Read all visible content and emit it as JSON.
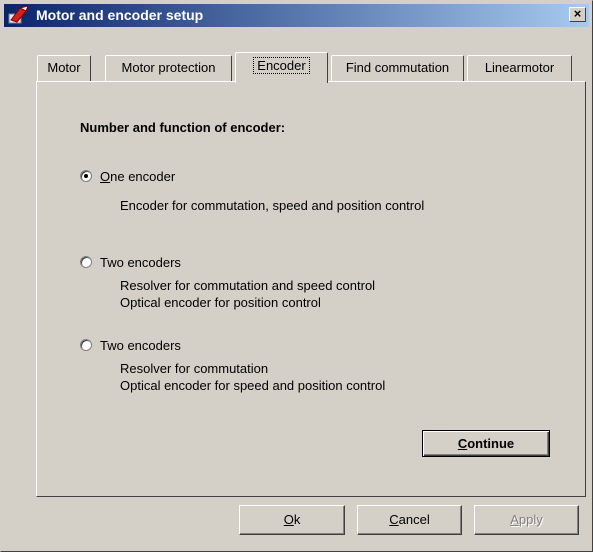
{
  "window": {
    "title": "Motor and encoder setup",
    "icon": "motor-app-icon",
    "close_glyph": "×"
  },
  "tabs": [
    {
      "label": "Motor",
      "active": false
    },
    {
      "label": "Motor protection",
      "active": false
    },
    {
      "label": "Encoder",
      "active": true
    },
    {
      "label": "Find commutation",
      "active": false
    },
    {
      "label": "Linearmotor",
      "active": false
    }
  ],
  "panel": {
    "heading": "Number and function of encoder:",
    "options": [
      {
        "label_mnemonic": "O",
        "label_rest": "ne encoder",
        "selected": true,
        "desc": [
          "Encoder for commutation, speed and position control"
        ]
      },
      {
        "label": "Two encoders",
        "selected": false,
        "desc": [
          "Resolver for commutation and speed control",
          "Optical encoder for position control"
        ]
      },
      {
        "label": "Two encoders",
        "selected": false,
        "desc": [
          "Resolver for commutation",
          "Optical encoder for speed and position control"
        ]
      }
    ],
    "continue_mnemonic": "C",
    "continue_rest": "ontinue"
  },
  "buttons": {
    "ok_mnemonic": "O",
    "ok_rest": "k",
    "cancel_mnemonic": "C",
    "cancel_rest": "ancel",
    "apply_mnemonic": "A",
    "apply_rest": "pply"
  },
  "colors": {
    "title_gradient_start": "#0a246a",
    "title_gradient_end": "#a6caf0",
    "dialog_face": "#d4d0c8"
  }
}
